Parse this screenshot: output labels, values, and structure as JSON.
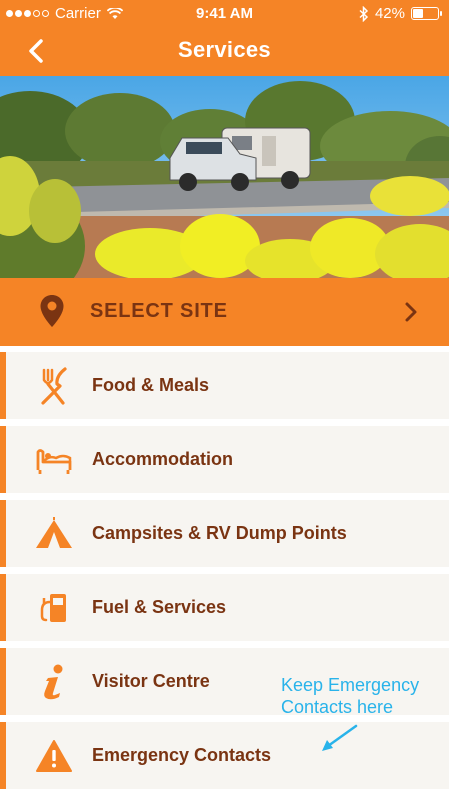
{
  "status_bar": {
    "carrier": "Carrier",
    "time": "9:41 AM",
    "battery_percent": "42%",
    "battery_level": 0.42,
    "signal_bars_filled": 3,
    "signal_bars_total": 5
  },
  "nav": {
    "title": "Services",
    "back_icon": "chevron-left-icon"
  },
  "hero": {
    "description_icon": "caravan-landscape-image"
  },
  "select_site": {
    "label": "SELECT SITE",
    "icon": "location-pin-icon",
    "chevron_icon": "chevron-right-icon"
  },
  "menu": {
    "items": [
      {
        "label": "Food & Meals",
        "icon": "fork-knife-icon"
      },
      {
        "label": "Accommodation",
        "icon": "bed-icon"
      },
      {
        "label": "Campsites & RV Dump Points",
        "icon": "tent-icon"
      },
      {
        "label": "Fuel & Services",
        "icon": "fuel-pump-icon"
      },
      {
        "label": "Visitor Centre",
        "icon": "info-icon"
      },
      {
        "label": "Emergency Contacts",
        "icon": "warning-icon"
      }
    ]
  },
  "annotation": {
    "line1": "Keep Emergency",
    "line2": "Contacts here"
  },
  "colors": {
    "brand_orange": "#f58426",
    "label_brown": "#7a3412",
    "row_background": "#f7f5f1",
    "annotation_blue": "#29b3ea"
  }
}
